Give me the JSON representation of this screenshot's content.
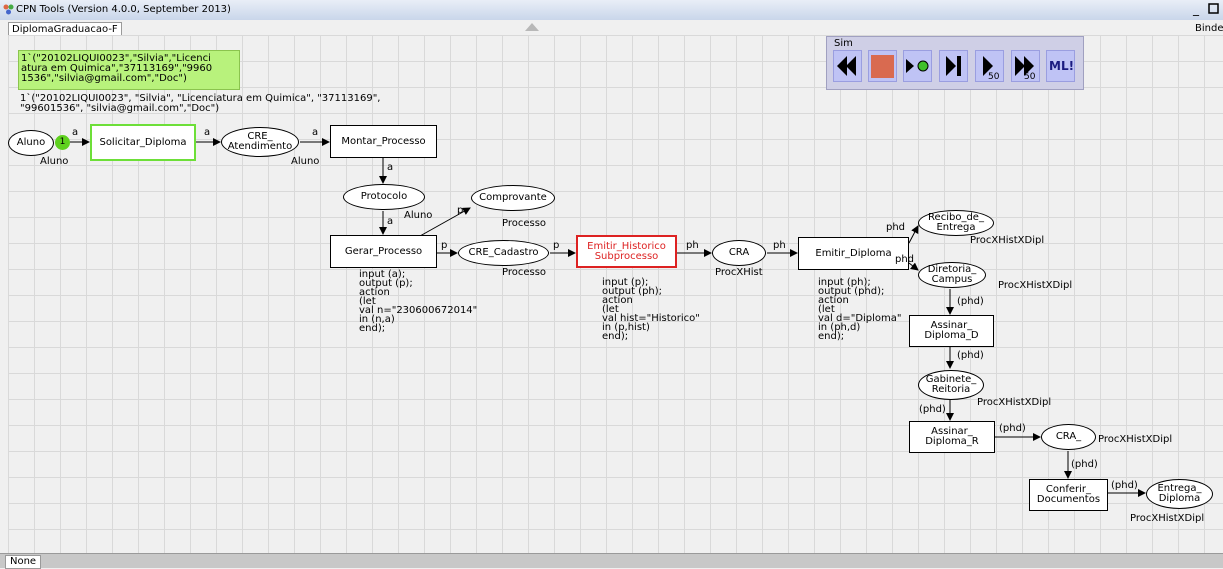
{
  "window": {
    "title": "CPN Tools (Version 4.0.0, September 2013)"
  },
  "tabs": {
    "page": "DiplomaGraduacao-F",
    "right": "Binde"
  },
  "status": {
    "tab": "None"
  },
  "marking": {
    "box": "1`(\"20102LIQUI0023\",\"Silvia\",\"Licenci\natura em Quimica\",\"37113169\",\"9960\n1536\",\"silvia@gmail.com\",\"Doc\")",
    "text": "1`(\"20102LIQUI0023\", \"Silvia\", \"Licenciatura em Quimica\", \"37113169\",\n\"99601536\", \"silvia@gmail.com\",\"Doc\")",
    "token_count": "1"
  },
  "sim": {
    "label": "Sim",
    "buttons": [
      "rewind-icon",
      "stop-icon",
      "play-icon",
      "step-icon",
      "play-n-icon",
      "fast-forward-icon",
      "ml-icon"
    ],
    "play_steps": "50",
    "ff_steps": "50",
    "ml_label": "ML!"
  },
  "places": {
    "aluno": {
      "name": "Aluno",
      "type": "Aluno"
    },
    "cre_atendimento": {
      "name": "CRE_\nAtendimento",
      "type": "Aluno"
    },
    "protocolo": {
      "name": "Protocolo",
      "type": "Aluno"
    },
    "comprovante": {
      "name": "Comprovante",
      "type": "Processo"
    },
    "cre_cadastro": {
      "name": "CRE_Cadastro",
      "type": "Processo"
    },
    "cra": {
      "name": "CRA",
      "type": "ProcXHist"
    },
    "recibo": {
      "name": "Recibo_de_\nEntrega",
      "type": "ProcXHistXDipl"
    },
    "diretoria": {
      "name": "Diretoria_\nCampus",
      "type": "ProcXHistXDipl"
    },
    "gabinete": {
      "name": "Gabinete_\nReitoria",
      "type": "ProcXHistXDipl"
    },
    "cra2": {
      "name": "CRA_",
      "type": "ProcXHistXDipl"
    },
    "entrega": {
      "name": "Entrega_\nDiploma",
      "type": "ProcXHistXDipl"
    }
  },
  "transitions": {
    "solicitar": "Solicitar_Diploma",
    "montar": "Montar_Processo",
    "gerar": "Gerar_Processo",
    "emitir_hist": "Emitir_Historico\nSubprocesso",
    "emitir_dipl": "Emitir_Diploma",
    "assinar_d": "Assinar_\nDiploma_D",
    "assinar_r": "Assinar_\nDiploma_R",
    "conferir": "Conferir_\nDocumentos"
  },
  "code": {
    "gerar": "input (a);\noutput (p);\naction\n(let\nval n=\"230600672014\"\nin (n,a)\nend);",
    "emitir_hist": "input (p);\noutput (ph);\naction\n(let\nval hist=\"Historico\"\nin (p,hist)\nend);",
    "emitir_dipl": "input (ph);\noutput (phd);\naction\n(let\nval d=\"Diploma\"\nin (ph,d)\nend);"
  },
  "arcs": {
    "a": "a",
    "p": "p",
    "ph": "ph",
    "phd": "phd",
    "phd_paren": "(phd)"
  },
  "colors": {
    "token": "#5fd11f",
    "marking": "#b8f27c",
    "subpage": "#dd2222",
    "sim_button": "#bfc3f5",
    "stop": "#d96a50"
  }
}
